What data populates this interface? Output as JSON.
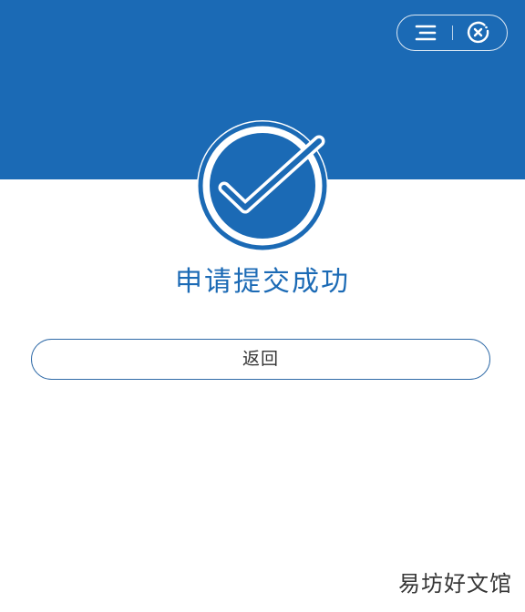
{
  "colors": {
    "primary": "#1b6ab5",
    "background": "#ffffff",
    "button_border": "#2f6aa7"
  },
  "header": {
    "capsule": {
      "menu_icon": "menu-icon",
      "close_icon": "close-circle-icon"
    }
  },
  "status": {
    "icon": "check-circle-icon",
    "title": "申请提交成功"
  },
  "actions": {
    "back_label": "返回"
  },
  "watermark": {
    "text": "易坊好文馆"
  }
}
